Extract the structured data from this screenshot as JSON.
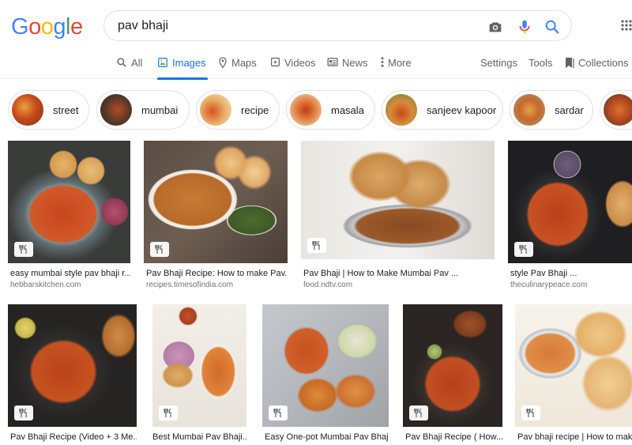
{
  "logo": {
    "letters": [
      "G",
      "o",
      "o",
      "g",
      "l",
      "e"
    ],
    "colors": [
      "#4285f4",
      "#ea4335",
      "#fbbc05",
      "#4285f4",
      "#34a853",
      "#ea4335"
    ]
  },
  "search": {
    "query": "pav bhaji"
  },
  "tabs": {
    "all": "All",
    "images": "Images",
    "maps": "Maps",
    "videos": "Videos",
    "news": "News",
    "more": "More",
    "settings": "Settings",
    "tools": "Tools",
    "collections": "Collections"
  },
  "chips": [
    "street",
    "mumbai",
    "recipe",
    "masala",
    "sanjeev kapoor",
    "sardar"
  ],
  "row1": [
    {
      "title": "easy mumbai style pav bhaji r...",
      "source": "hebbarskitchen.com"
    },
    {
      "title": "Pav Bhaji Recipe: How to make Pav...",
      "source": "recipes.timesofindia.com"
    },
    {
      "title": "Pav Bhaji | How to Make Mumbai Pav ...",
      "source": "food.ndtv.com"
    },
    {
      "title": "style Pav Bhaji ...",
      "source": "theculinarypeace.com"
    }
  ],
  "row2": [
    {
      "title": "Pav Bhaji Recipe (Video + 3 Me..."
    },
    {
      "title": "Best Mumbai Pav Bhaji..."
    },
    {
      "title": "Easy One-pot Mumbai Pav Bhaj..."
    },
    {
      "title": "Pav Bhaji Recipe ( How..."
    },
    {
      "title": "Pav bhaji recipe | How to make"
    }
  ],
  "colors": {
    "accent": "#1a73e8",
    "muted": "#5f6368"
  },
  "icons": {
    "badge": "fork-knife-icon"
  }
}
